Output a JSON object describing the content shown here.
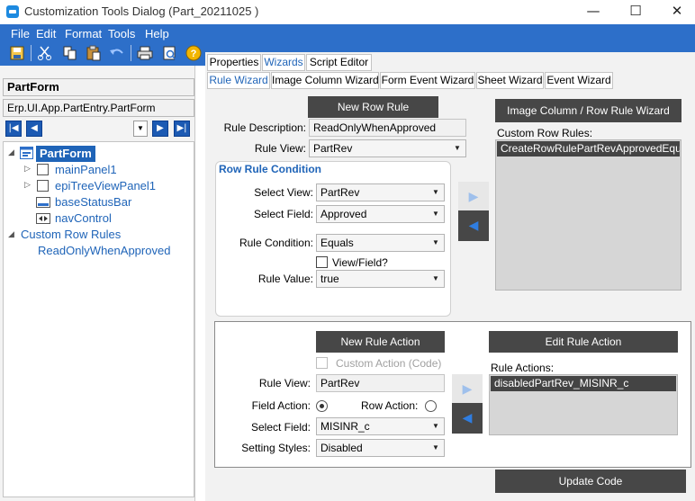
{
  "window": {
    "title": "Customization Tools Dialog  (Part_20211025 )",
    "minimize": "—",
    "maximize": "☐",
    "close": "✕"
  },
  "menu": [
    "File",
    "Edit",
    "Format",
    "Tools",
    "Help"
  ],
  "toolbar": [
    "save-icon",
    "cut-icon",
    "copy-icon",
    "paste-icon",
    "undo-icon",
    "print-icon",
    "print-preview-icon",
    "help-icon"
  ],
  "left": {
    "form_name": "PartForm",
    "form_path": "Erp.UI.App.PartEntry.PartForm",
    "tree": {
      "root": "PartForm",
      "children": [
        "mainPanel1",
        "epiTreeViewPanel1",
        "baseStatusBar",
        "navControl"
      ],
      "custom_rules_label": "Custom Row Rules",
      "custom_rules": [
        "ReadOnlyWhenApproved"
      ]
    }
  },
  "tabs": [
    "Properties",
    "Wizards",
    "Script Editor"
  ],
  "active_tab": "Wizards",
  "subtabs": [
    "Rule Wizard",
    "Image Column Wizard",
    "Form Event Wizard",
    "Sheet Wizard",
    "Event Wizard"
  ],
  "active_subtab": "Rule Wizard",
  "rule": {
    "new_row_rule": "New Row Rule",
    "image_column_btn": "Image Column / Row Rule Wizard",
    "description_label": "Rule Description:",
    "description_value": "ReadOnlyWhenApproved",
    "view_label": "Rule View:",
    "view_value": "PartRev",
    "custom_rows_label": "Custom Row Rules:",
    "custom_rows": [
      "CreateRowRulePartRevApprovedEqu..."
    ]
  },
  "condition": {
    "title": "Row Rule Condition",
    "select_view_label": "Select View:",
    "select_view_value": "PartRev",
    "select_field_label": "Select Field:",
    "select_field_value": "Approved",
    "rule_condition_label": "Rule Condition:",
    "rule_condition_value": "Equals",
    "view_field_label": "View/Field?",
    "view_field_checked": false,
    "rule_value_label": "Rule Value:",
    "rule_value": "true"
  },
  "action": {
    "new_rule_action": "New Rule Action",
    "edit_rule_action": "Edit Rule Action",
    "custom_action_label": "Custom Action (Code)",
    "custom_action_checked": false,
    "rule_view_label": "Rule View:",
    "rule_view_value": "PartRev",
    "field_action_label": "Field Action:",
    "field_action_selected": true,
    "row_action_label": "Row Action:",
    "row_action_selected": false,
    "select_field_label": "Select Field:",
    "select_field_value": "MISINR_c",
    "setting_styles_label": "Setting Styles:",
    "setting_styles_value": "Disabled",
    "rule_actions_label": "Rule Actions:",
    "rule_actions": [
      "disabledPartRev_MISINR_c"
    ]
  },
  "update_code": "Update Code",
  "colors": {
    "brand_blue": "#2d6fc9",
    "selection_blue": "#1f64b8",
    "dark_button": "#474747"
  }
}
